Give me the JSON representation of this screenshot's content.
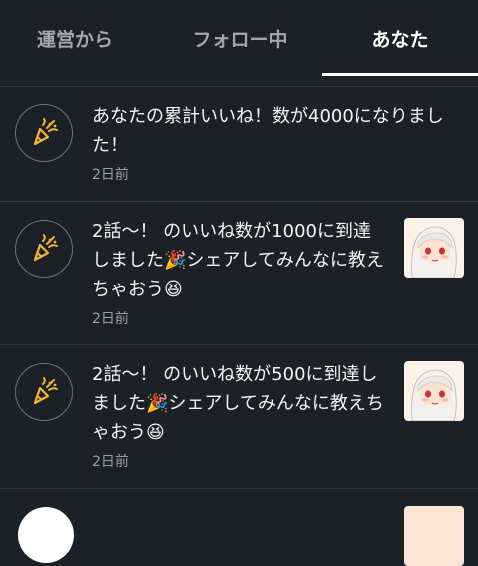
{
  "tabs": [
    {
      "label": "運営から",
      "active": false
    },
    {
      "label": "フォロー中",
      "active": false
    },
    {
      "label": "あなた",
      "active": true
    }
  ],
  "notifications": [
    {
      "icon": "party-popper-icon",
      "message": "あなたの累計いいね！数が4000になりました！",
      "time": "2日前",
      "has_thumbnail": false
    },
    {
      "icon": "party-popper-icon",
      "message": "2話〜！ のいいね数が1000に到達しました🎉シェアしてみんなに教えちゃおう😆",
      "time": "2日前",
      "has_thumbnail": true
    },
    {
      "icon": "party-popper-icon",
      "message": "2話〜！ のいいね数が500に到達しました🎉シェアしてみんなに教えちゃおう😆",
      "time": "2日前",
      "has_thumbnail": true
    }
  ],
  "colors": {
    "background": "#1c2027",
    "accent_icon": "#f2b33a",
    "active_tab": "#ffffff",
    "inactive_tab": "#a3a7ad"
  }
}
